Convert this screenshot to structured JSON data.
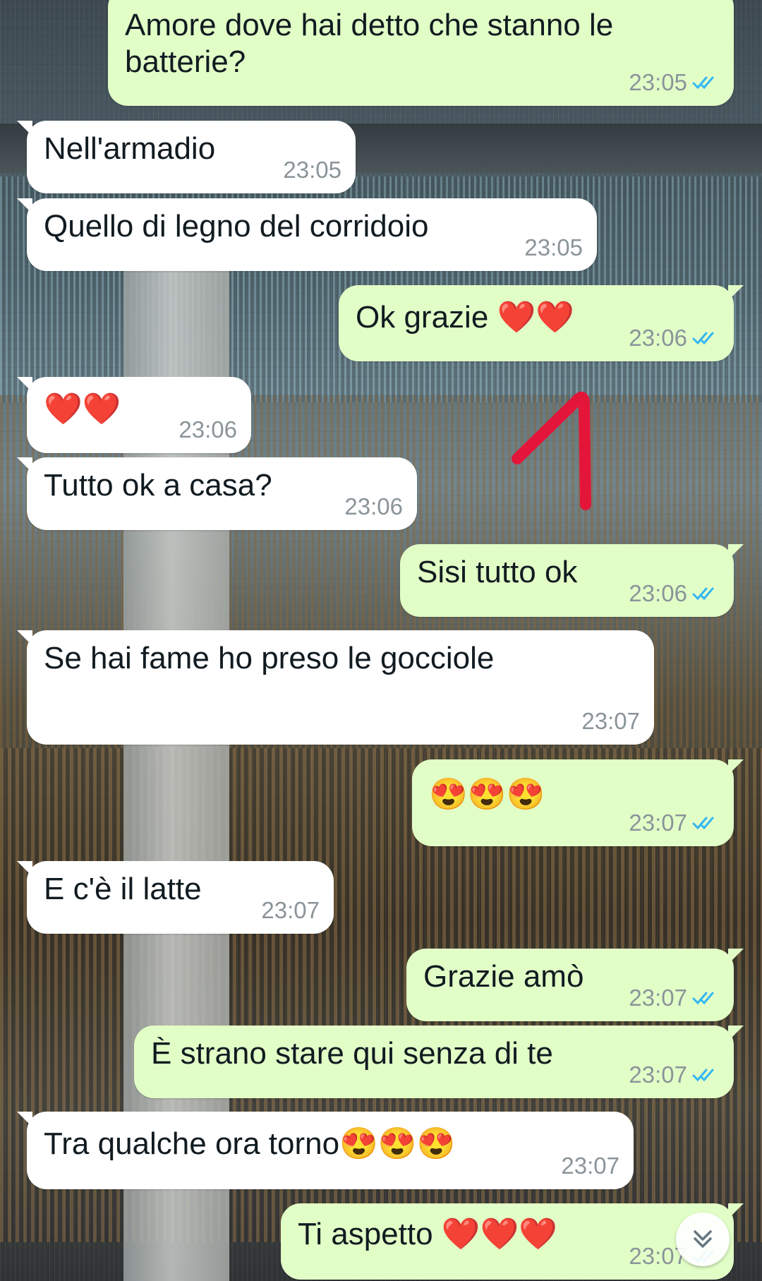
{
  "colors": {
    "incoming_bubble": "#ffffff",
    "outgoing_bubble": "#e2fec7",
    "read_ticks": "#34b7f1",
    "timestamp": "#8a9499",
    "annotation_arrow": "#e3163a"
  },
  "messages": [
    {
      "direction": "out",
      "text": "Amore dove hai detto che stanno le batterie?",
      "time": "23:05",
      "status": "read"
    },
    {
      "direction": "in",
      "text": "Nell'armadio",
      "time": "23:05"
    },
    {
      "direction": "in",
      "text": "Quello di legno del corridoio",
      "time": "23:05"
    },
    {
      "direction": "out",
      "text": "Ok grazie ❤️❤️",
      "time": "23:06",
      "status": "read"
    },
    {
      "direction": "in",
      "text": "❤️❤️",
      "time": "23:06"
    },
    {
      "direction": "in",
      "text": "Tutto ok a casa?",
      "time": "23:06"
    },
    {
      "direction": "out",
      "text": "Sisi tutto ok",
      "time": "23:06",
      "status": "read"
    },
    {
      "direction": "in",
      "text": "Se hai fame ho preso le gocciole",
      "time": "23:07"
    },
    {
      "direction": "out",
      "text": "😍😍😍",
      "time": "23:07",
      "status": "read"
    },
    {
      "direction": "in",
      "text": "E c'è il latte",
      "time": "23:07"
    },
    {
      "direction": "out",
      "text": "Grazie amò",
      "time": "23:07",
      "status": "read"
    },
    {
      "direction": "out",
      "text": "È strano stare qui senza di te",
      "time": "23:07",
      "status": "read"
    },
    {
      "direction": "in",
      "text": "Tra qualche ora torno😍😍😍",
      "time": "23:07"
    },
    {
      "direction": "out",
      "text": "Ti aspetto ❤️❤️❤️",
      "time": "23:07",
      "status": "read"
    }
  ],
  "icons": {
    "read_receipt": "double-check-icon",
    "scroll_down": "chevron-double-down-icon",
    "annotation": "hand-drawn-arrow"
  }
}
